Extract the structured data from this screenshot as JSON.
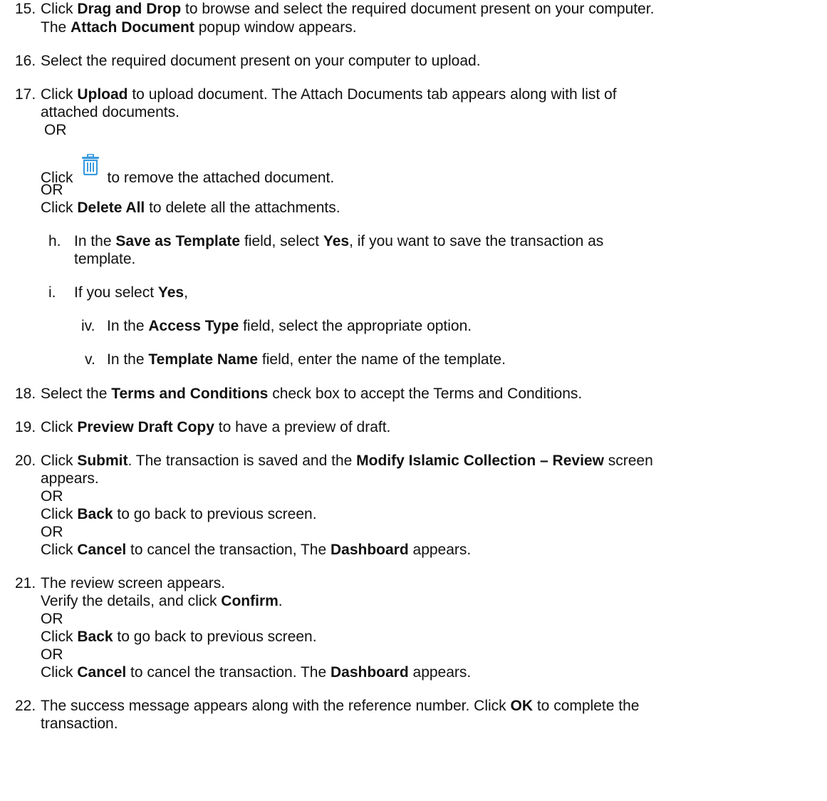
{
  "steps": {
    "s15": {
      "num": "15.",
      "l1": [
        "Click ",
        "Drag and Drop",
        " to browse and select the required document present on your computer."
      ],
      "l2": [
        "The ",
        "Attach Document",
        " popup window appears."
      ]
    },
    "s16": {
      "num": "16.",
      "l1": "Select the required document present on your computer to upload."
    },
    "s17": {
      "num": "17.",
      "l1": [
        "Click ",
        "Upload",
        " to upload document. The Attach Documents tab appears along with list of"
      ],
      "l2": "attached documents.",
      "or1": "OR",
      "trash_a": "Click",
      "trash_b": "to remove the attached document.",
      "or2": "OR",
      "l5": [
        "Click ",
        "Delete All",
        " to delete all the attachments."
      ]
    },
    "sh": {
      "letter": "h.",
      "l1": [
        "In the ",
        "Save as Template",
        " field, select ",
        "Yes",
        ", if you want to save the transaction as"
      ],
      "l2": "template."
    },
    "si": {
      "letter": "i.",
      "l1": [
        "If you select ",
        "Yes",
        ","
      ]
    },
    "siv": {
      "roman": "iv.",
      "l1": [
        "In the ",
        "Access Type",
        " field, select the appropriate option."
      ]
    },
    "sv": {
      "roman": "v.",
      "l1": [
        "In the ",
        "Template Name",
        " field, enter the name of the template."
      ]
    },
    "s18": {
      "num": "18.",
      "l1": [
        "Select the ",
        "Terms and Conditions",
        " check box to accept the Terms and Conditions."
      ]
    },
    "s19": {
      "num": "19.",
      "l1": [
        "Click ",
        "Preview Draft Copy",
        " to have a preview of draft."
      ]
    },
    "s20": {
      "num": "20.",
      "l1": [
        "Click ",
        "Submit",
        ". The transaction is saved and the ",
        "Modify Islamic Collection – Review",
        " screen"
      ],
      "l2": "appears.",
      "or1": "OR",
      "l4": [
        "Click ",
        "Back",
        " to go back to previous screen."
      ],
      "or2": "OR",
      "l6": [
        "Click ",
        "Cancel",
        " to cancel the transaction, The ",
        "Dashboard",
        " appears."
      ]
    },
    "s21": {
      "num": "21.",
      "l1": "The review screen appears.",
      "l2": [
        "Verify the details, and click ",
        "Confirm",
        "."
      ],
      "or1": "OR",
      "l4": [
        "Click ",
        "Back",
        " to go back to previous screen."
      ],
      "or2": "OR",
      "l6": [
        "Click ",
        "Cancel",
        " to cancel the transaction. The ",
        "Dashboard",
        " appears."
      ]
    },
    "s22": {
      "num": "22.",
      "l1": [
        "The success message appears along with the reference number. Click ",
        "OK",
        " to complete the"
      ],
      "l2": "transaction."
    }
  },
  "colors": {
    "trash_icon": "#3b9be0"
  },
  "icons": {
    "trash": "trash-icon"
  }
}
